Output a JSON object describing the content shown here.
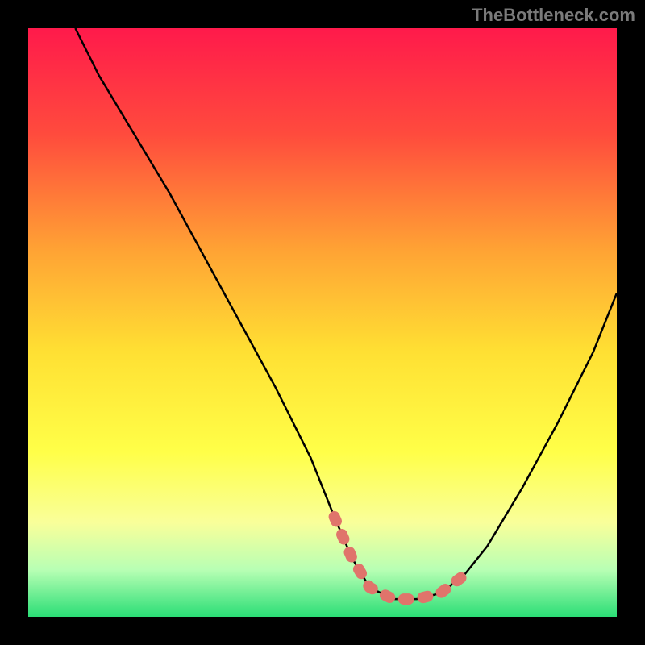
{
  "watermark": "TheBottleneck.com",
  "chart_data": {
    "type": "line",
    "title": "",
    "xlabel": "",
    "ylabel": "",
    "xlim": [
      0,
      100
    ],
    "ylim": [
      0,
      100
    ],
    "gradient_stops": [
      {
        "offset": 0,
        "color": "#ff1a4b"
      },
      {
        "offset": 18,
        "color": "#ff4b3d"
      },
      {
        "offset": 38,
        "color": "#ffa434"
      },
      {
        "offset": 55,
        "color": "#ffe033"
      },
      {
        "offset": 72,
        "color": "#ffff48"
      },
      {
        "offset": 84,
        "color": "#f9ff9a"
      },
      {
        "offset": 92,
        "color": "#b8ffb4"
      },
      {
        "offset": 100,
        "color": "#2bde76"
      }
    ],
    "series": [
      {
        "name": "bottleneck-curve",
        "x": [
          8,
          12,
          18,
          24,
          30,
          36,
          42,
          48,
          52,
          55,
          58,
          62,
          66,
          70,
          74,
          78,
          84,
          90,
          96,
          100
        ],
        "values": [
          100,
          92,
          82,
          72,
          61,
          50,
          39,
          27,
          17,
          10,
          5,
          3,
          3,
          4,
          7,
          12,
          22,
          33,
          45,
          55
        ]
      }
    ],
    "highlight_segment": {
      "name": "optimal-range",
      "x": [
        52,
        55,
        58,
        62,
        66,
        70,
        74
      ],
      "values": [
        17,
        10,
        5,
        3,
        3,
        4,
        7
      ]
    }
  }
}
